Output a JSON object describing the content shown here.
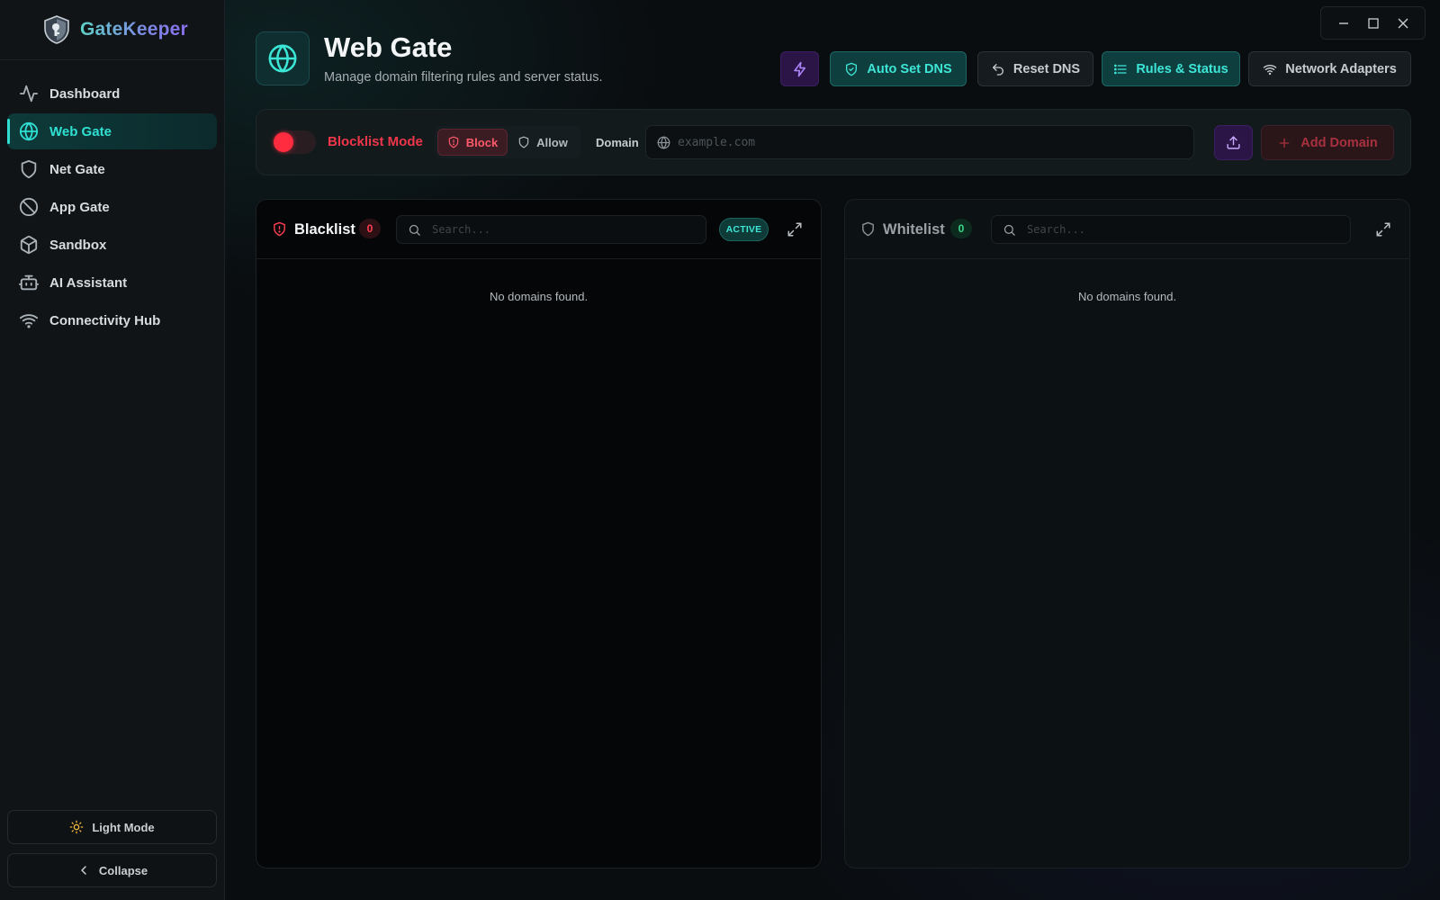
{
  "app": {
    "name": "GateKeeper"
  },
  "sidebar": {
    "items": [
      {
        "label": "Dashboard",
        "icon": "activity-icon"
      },
      {
        "label": "Web Gate",
        "icon": "globe-icon",
        "active": true
      },
      {
        "label": "Net Gate",
        "icon": "shield-icon"
      },
      {
        "label": "App Gate",
        "icon": "ban-icon"
      },
      {
        "label": "Sandbox",
        "icon": "box-icon"
      },
      {
        "label": "AI Assistant",
        "icon": "bot-icon"
      },
      {
        "label": "Connectivity Hub",
        "icon": "wifi-icon"
      }
    ],
    "light_mode_label": "Light Mode",
    "collapse_label": "Collapse"
  },
  "header": {
    "title": "Web Gate",
    "subtitle": "Manage domain filtering rules and server status."
  },
  "toolbar": {
    "auto_dns_label": "Auto Set DNS",
    "reset_dns_label": "Reset DNS",
    "rules_label": "Rules & Status",
    "adapters_label": "Network Adapters"
  },
  "controls": {
    "mode_label": "Blocklist Mode",
    "mode_enabled": true,
    "block_label": "Block",
    "allow_label": "Allow",
    "selected_action": "Block",
    "domain_label": "Domain",
    "domain_placeholder": "example.com",
    "domain_value": "",
    "add_label": "Add Domain"
  },
  "blacklist": {
    "title": "Blacklist",
    "count": "0",
    "search_placeholder": "Search...",
    "status": "ACTIVE",
    "empty_text": "No domains found."
  },
  "whitelist": {
    "title": "Whitelist",
    "count": "0",
    "search_placeholder": "Search...",
    "empty_text": "No domains found."
  },
  "colors": {
    "accent": "#2fe0d2",
    "danger": "#ff2b3e",
    "purple": "#b086ff",
    "success": "#3ad98a"
  }
}
